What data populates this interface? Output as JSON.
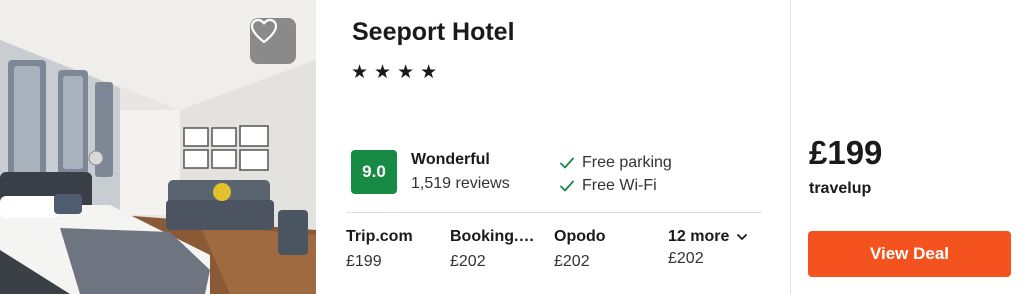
{
  "photo": {
    "alt": "Hotel room with bed, sofa and framed pictures"
  },
  "favorite": {
    "icon": "heart-outline-icon"
  },
  "hotel": {
    "name": "Seeport Hotel",
    "stars": [
      "★",
      "★",
      "★",
      "★"
    ],
    "rating": {
      "score": "9.0",
      "label": "Wonderful",
      "reviews": "1,519 reviews",
      "color": "#178a44"
    },
    "amenities": [
      {
        "icon": "check-icon",
        "label": "Free parking"
      },
      {
        "icon": "check-icon",
        "label": "Free Wi-Fi"
      }
    ],
    "providers": [
      {
        "name": "Trip.com",
        "price": "£199"
      },
      {
        "name": "Booking.…",
        "price": "£202"
      },
      {
        "name": "Opodo",
        "price": "£202"
      }
    ],
    "more": {
      "label": "12 more",
      "price": "£202",
      "icon": "chevron-down-icon"
    }
  },
  "deal": {
    "price": "£199",
    "provider": "travelup",
    "button_label": "View Deal",
    "button_color": "#f4521e"
  }
}
